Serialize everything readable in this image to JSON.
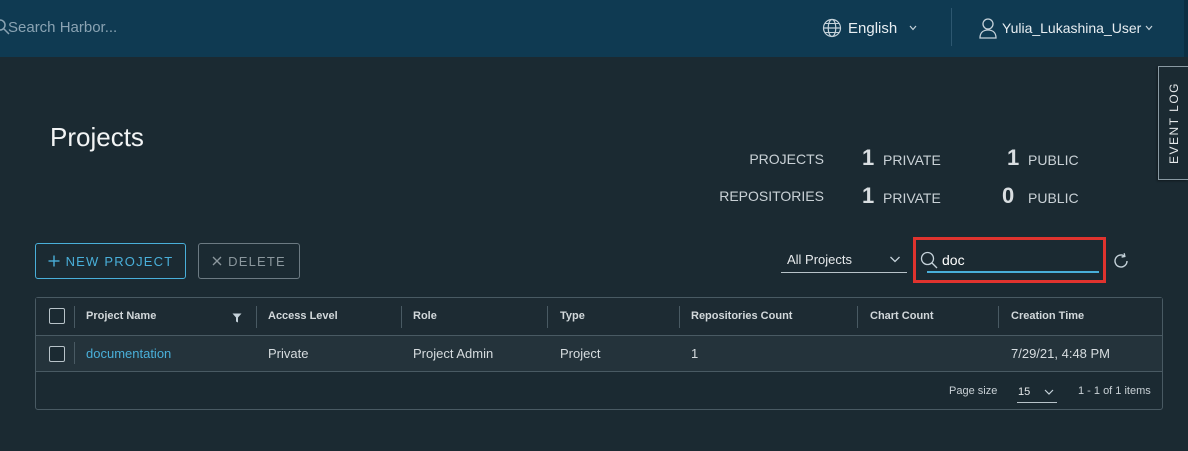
{
  "header": {
    "search_placeholder": "Search Harbor...",
    "language": "English",
    "user": "Yulia_Lukashina_User"
  },
  "event_log": "EVENT LOG",
  "page_title": "Projects",
  "stats": {
    "projects_label": "PROJECTS",
    "repositories_label": "REPOSITORIES",
    "projects_private": "1",
    "projects_public": "1",
    "repositories_private": "1",
    "repositories_public": "0",
    "private_label": "PRIVATE",
    "public_label": "PUBLIC"
  },
  "toolbar": {
    "new_project": "NEW PROJECT",
    "delete": "DELETE",
    "filter_selected": "All Projects",
    "search_value": "doc"
  },
  "table": {
    "columns": [
      "Project Name",
      "Access Level",
      "Role",
      "Type",
      "Repositories Count",
      "Chart Count",
      "Creation Time"
    ],
    "rows": [
      {
        "project_name": "documentation",
        "access_level": "Private",
        "role": "Project Admin",
        "type": "Project",
        "repositories_count": "1",
        "chart_count": "",
        "creation_time": "7/29/21, 4:48 PM"
      }
    ],
    "page_size_label": "Page size",
    "page_size": "15",
    "items_summary": "1 - 1 of 1 items"
  },
  "colors": {
    "header_bg": "#0f3a52",
    "page_bg": "#1b2a32",
    "accent": "#49afd9",
    "highlight": "#e0332e"
  }
}
